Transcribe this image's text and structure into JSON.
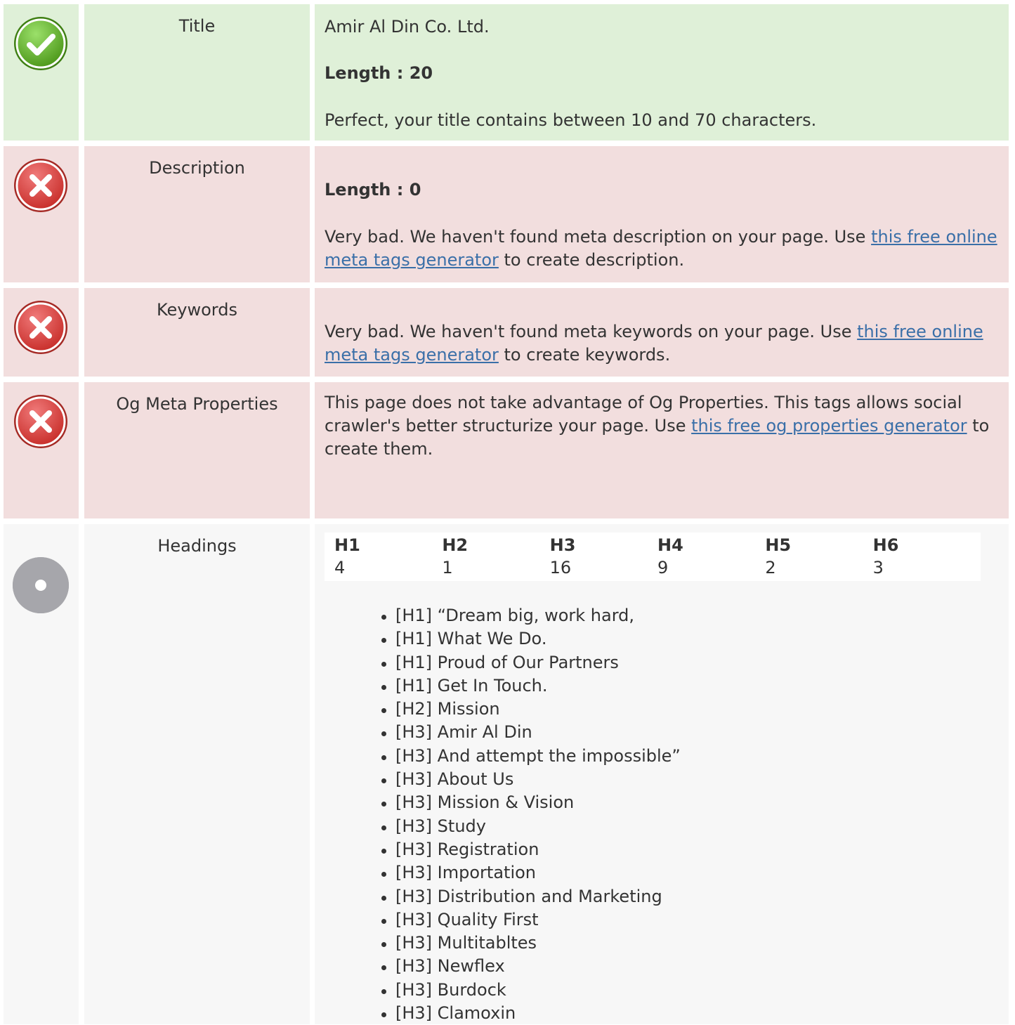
{
  "rows": {
    "title": {
      "label": "Title",
      "value": "Amir Al Din Co. Ltd.",
      "length": "Length : 20",
      "message": "Perfect, your title contains between 10 and 70 characters.",
      "status": "good"
    },
    "description": {
      "label": "Description",
      "length": "Length : 0",
      "message_before": "Very bad. We haven't found meta description on your page. Use ",
      "link": "this free online meta tags generator",
      "message_after": " to create description.",
      "status": "bad"
    },
    "keywords": {
      "label": "Keywords",
      "message_before": "Very bad. We haven't found meta keywords on your page. Use ",
      "link": "this free online meta tags generator",
      "message_after": " to create keywords.",
      "status": "bad"
    },
    "og": {
      "label": "Og Meta Properties",
      "message_before": "This page does not take advantage of Og Properties. This tags allows social crawler's better structurize your page. Use ",
      "link": "this free og properties generator",
      "message_after": " to create them.",
      "status": "bad"
    },
    "headings": {
      "label": "Headings",
      "status": "info",
      "counts": [
        {
          "tag": "H1",
          "count": "4"
        },
        {
          "tag": "H2",
          "count": "1"
        },
        {
          "tag": "H3",
          "count": "16"
        },
        {
          "tag": "H4",
          "count": "9"
        },
        {
          "tag": "H5",
          "count": "2"
        },
        {
          "tag": "H6",
          "count": "3"
        }
      ],
      "list": [
        "[H1] “Dream big, work hard,",
        "[H1] What We Do.",
        "[H1] Proud of Our Partners",
        "[H1] Get In Touch.",
        "[H2] Mission",
        "[H3] Amir Al Din",
        "[H3] And attempt the impossible”",
        "[H3] About Us",
        "[H3] Mission & Vision",
        "[H3] Study",
        "[H3] Registration",
        "[H3] Importation",
        "[H3] Distribution and Marketing",
        "[H3] Quality First",
        "[H3] Multitabltes",
        "[H3] Newflex",
        "[H3] Burdock",
        "[H3] Clamoxin"
      ]
    }
  },
  "icons": {
    "good": "check-icon",
    "bad": "error-x-icon",
    "info": "info-dot-icon"
  },
  "colors": {
    "good_bg": "#dff0d8",
    "bad_bg": "#f2dede",
    "info_bg": "#f7f7f7",
    "link": "#3a6fa8"
  }
}
